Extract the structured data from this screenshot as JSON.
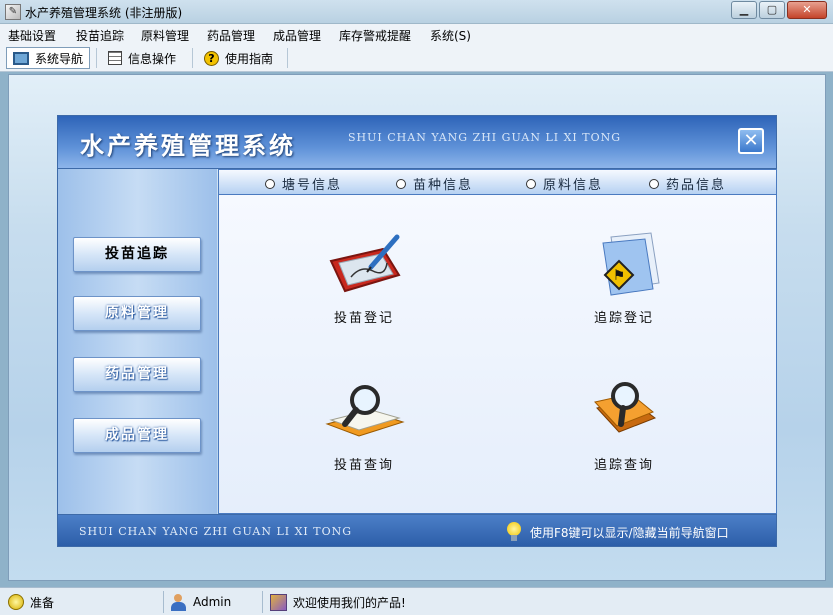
{
  "window": {
    "title": "水产养殖管理系统 (非注册版)",
    "controls": [
      "minimize",
      "maximize",
      "close"
    ]
  },
  "menu": [
    "基础设置",
    "投苗追踪",
    "原料管理",
    "药品管理",
    "成品管理",
    "库存警戒提醒",
    "系统(S)"
  ],
  "toolbar": {
    "items": [
      {
        "label": "系统导航",
        "icon": "monitor-icon",
        "active": true
      },
      {
        "label": "信息操作",
        "icon": "grid-icon",
        "active": false
      },
      {
        "label": "使用指南",
        "icon": "help-icon",
        "active": false
      }
    ]
  },
  "panel": {
    "title": "水产养殖管理系统",
    "subtitle": "SHUI CHAN YANG ZHI GUAN LI XI TONG",
    "close_glyph": "✕",
    "nav": [
      "投苗追踪",
      "原料管理",
      "药品管理",
      "成品管理"
    ],
    "tabs": [
      "塘号信息",
      "苗种信息",
      "原料信息",
      "药品信息"
    ],
    "actions": [
      {
        "label": "投苗登记",
        "icon": "tablet-pen-icon"
      },
      {
        "label": "追踪登记",
        "icon": "folder-sign-icon"
      },
      {
        "label": "投苗查询",
        "icon": "book-magnifier-icon"
      },
      {
        "label": "追踪查询",
        "icon": "folder-magnifier-icon"
      }
    ],
    "footer_subtitle": "SHUI CHAN YANG ZHI GUAN LI XI TONG",
    "footer_hint": "使用F8键可以显示/隐藏当前导航窗口"
  },
  "status": {
    "ready": "准备",
    "user": "Admin",
    "welcome": "欢迎使用我们的产品!"
  },
  "colors": {
    "header_blue": "#2e64b8",
    "nav_text": "#ffffff",
    "workspace_bg": "#c7ddee"
  }
}
